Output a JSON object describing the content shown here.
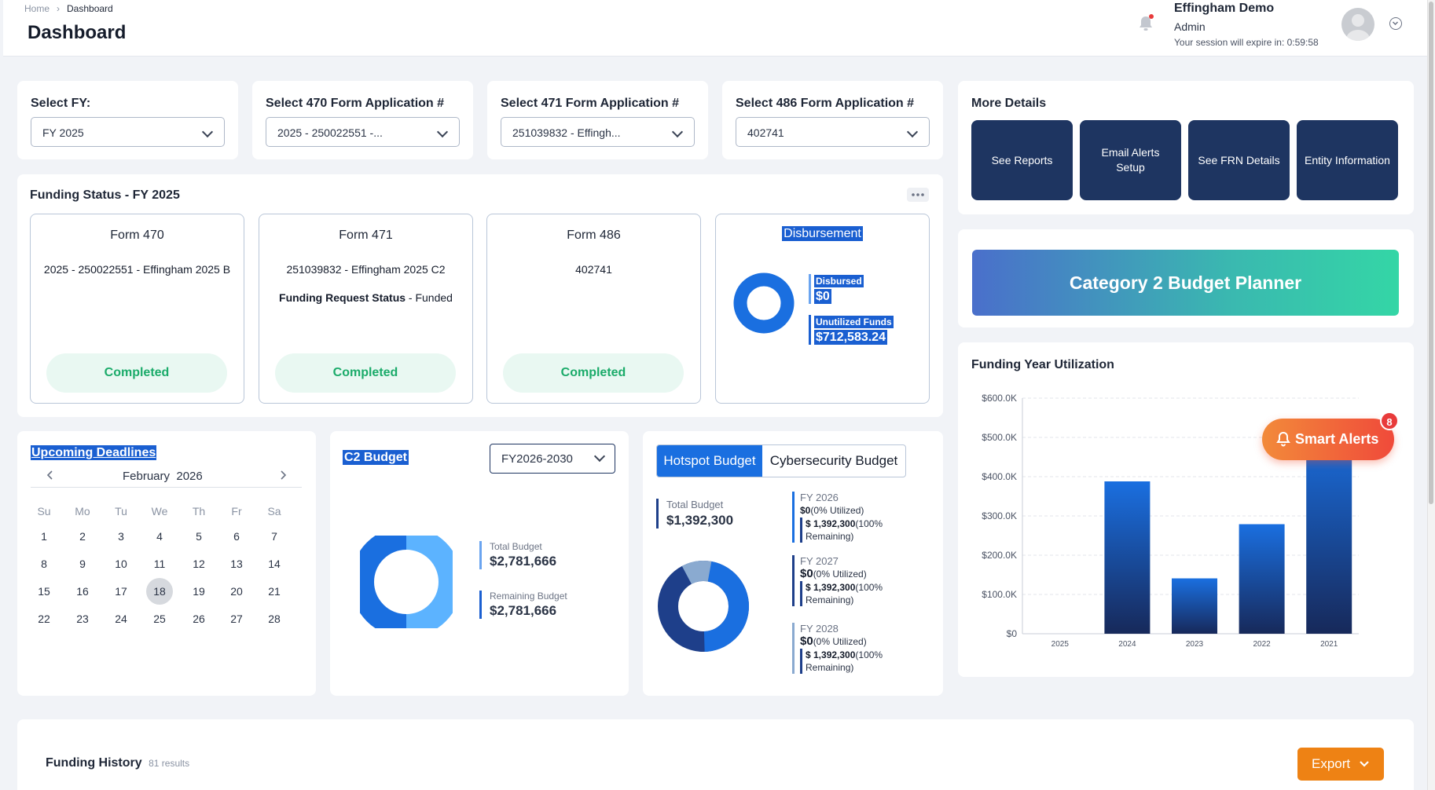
{
  "breadcrumb": {
    "home": "Home",
    "current": "Dashboard"
  },
  "page_title": "Dashboard",
  "user": {
    "name": "Effingham Demo",
    "role": "Admin",
    "session": "Your session will expire in: 0:59:58"
  },
  "selectors": [
    {
      "label": "Select FY:",
      "value": "FY 2025"
    },
    {
      "label": "Select 470 Form Application #",
      "value": "2025 - 250022551 -..."
    },
    {
      "label": "Select 471 Form Application #",
      "value": "251039832 - Effingh..."
    },
    {
      "label": "Select 486 Form Application #",
      "value": "402741"
    }
  ],
  "funding_status": {
    "title": "Funding Status  - FY 2025",
    "form470": {
      "heading": "Form 470",
      "text": "2025 - 250022551 - Effingham 2025 B",
      "status": "Completed"
    },
    "form471": {
      "heading": "Form 471",
      "text": "251039832 - Effingham 2025 C2",
      "frs_label": "Funding Request Status",
      "frs_value": " - Funded",
      "status": "Completed"
    },
    "form486": {
      "heading": "Form 486",
      "text": "402741",
      "status": "Completed"
    },
    "disbursement": {
      "heading": "Disbursement",
      "disbursed_label": "Disbursed",
      "disbursed_value": "$0",
      "unutilized_label": "Unutilized Funds",
      "unutilized_value": "$712,583.24"
    }
  },
  "more_details": {
    "title": "More Details",
    "buttons": [
      "See Reports",
      "Email Alerts Setup",
      "See FRN Details",
      "Entity Information"
    ]
  },
  "c2_planner": "Category 2 Budget Planner",
  "deadlines": {
    "title": "Upcoming Deadlines",
    "month": "February",
    "year": "2026",
    "weekdays": [
      "Su",
      "Mo",
      "Tu",
      "We",
      "Th",
      "Fr",
      "Sa"
    ],
    "weeks": [
      [
        "1",
        "2",
        "3",
        "4",
        "5",
        "6",
        "7"
      ],
      [
        "8",
        "9",
        "10",
        "11",
        "12",
        "13",
        "14"
      ],
      [
        "15",
        "16",
        "17",
        "18",
        "19",
        "20",
        "21"
      ],
      [
        "22",
        "23",
        "24",
        "25",
        "26",
        "27",
        "28"
      ]
    ],
    "today": "18"
  },
  "c2_budget": {
    "title": "C2 Budget",
    "select_value": "FY2026-2030",
    "total_label": "Total Budget",
    "total_value": "$2,781,666",
    "remaining_label": "Remaining Budget",
    "remaining_value": "$2,781,666"
  },
  "hotspot": {
    "tab_active": "Hotspot Budget",
    "tab_other": "Cybersecurity Budget",
    "total_label": "Total Budget",
    "total_value": "$1,392,300",
    "years": [
      {
        "label": "FY 2026",
        "value": "$0",
        "utilized": "(0% Utilized)",
        "remaining_value": "$ 1,392,300",
        "remaining_pct": "(100%",
        "remaining_word": "Remaining)"
      },
      {
        "label": "FY 2027",
        "value": "$0",
        "utilized": "(0% Utilized)",
        "remaining_value": "$ 1,392,300",
        "remaining_pct": "(100%",
        "remaining_word": "Remaining)"
      },
      {
        "label": "FY 2028",
        "value": "$0",
        "utilized": "(0% Utilized)",
        "remaining_value": "$ 1,392,300",
        "remaining_pct": "(100%",
        "remaining_word": "Remaining)"
      }
    ],
    "colors": [
      "#1a6fe0",
      "#1e3f8a",
      "#8aaad0"
    ]
  },
  "utilization": {
    "title": "Funding Year Utilization"
  },
  "chart_data": {
    "type": "bar",
    "categories": [
      "2025",
      "2024",
      "2023",
      "2022",
      "2021"
    ],
    "values": [
      0,
      388,
      141,
      279,
      520
    ],
    "yticks": [
      "$0",
      "$100.0K",
      "$200.0K",
      "$300.0K",
      "$400.0K",
      "$500.0K",
      "$600.0K"
    ],
    "ylim": [
      0,
      600
    ],
    "grid": true
  },
  "smart_alerts": {
    "label": "Smart Alerts",
    "count": "8"
  },
  "funding_history": {
    "title": "Funding History",
    "count": "81 results",
    "export": "Export"
  }
}
